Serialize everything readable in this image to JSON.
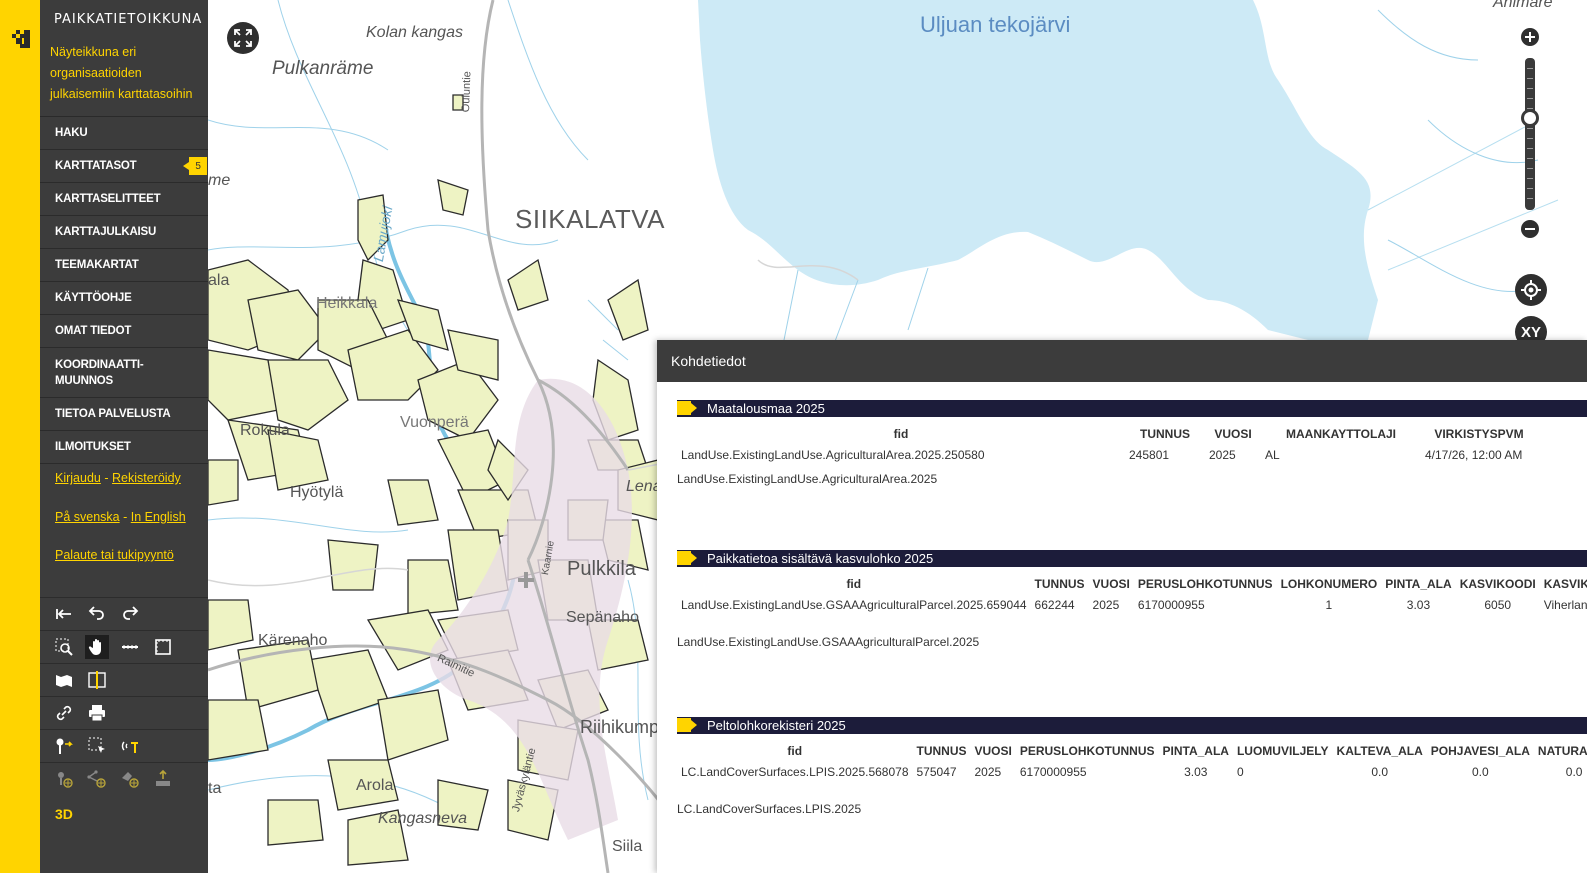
{
  "sidebar": {
    "brand": "PAIKKATIETOIKKUNA",
    "subtitle": "Näyteikkuna eri organisaatioiden julkaisemiin karttatasoihin",
    "menu": [
      {
        "label": "HAKU"
      },
      {
        "label": "KARTTATASOT",
        "badge": "5"
      },
      {
        "label": "KARTTASELITTEET"
      },
      {
        "label": "KARTTAJULKAISU"
      },
      {
        "label": "TEEMAKARTAT"
      },
      {
        "label": "KÄYTTÖOHJE"
      },
      {
        "label": "OMAT TIEDOT"
      },
      {
        "label": "KOORDINAATTI-\nMUUNNOS"
      },
      {
        "label": "TIETOA PALVELUSTA"
      },
      {
        "label": "ILMOITUKSET"
      }
    ],
    "login": "Kirjaudu",
    "register": "Rekisteröidy",
    "swedish": "På svenska",
    "english": "In English",
    "feedback": "Palaute tai tukipyyntö",
    "separator": "-",
    "button_3d": "3D"
  },
  "map": {
    "labels": {
      "lake": "Uljuan tekojärvi",
      "siikalatva": "SIIKALATVA",
      "kolankangas": "Kolan kangas",
      "pulkanrame": "Pulkanräme",
      "me": "me",
      "ala": "ala",
      "heikkala": "Heikkala",
      "rokula": "Rokula",
      "vuonpera": "Vuonperä",
      "hyotyla": "Hyötylä",
      "pulkkila": "Pulkkila",
      "sepanaho": "Sepänaho",
      "karenaho": "Kärenaho",
      "riihikump": "Riihikump",
      "arola": "Arola",
      "kangasneva": "Kangasneva",
      "lena": "Lena",
      "ta": "ta",
      "animare": "Animare",
      "siila": "Siila",
      "ouluntie": "Ouluntie",
      "lamujoki": "Lamujoki",
      "raimitie": "Raimitie",
      "jyvaskylantie": "Jyväskyläntie",
      "kaarnie": "Kaarnie"
    },
    "xy_button": "XY"
  },
  "popup": {
    "title": "Kohdetiedot",
    "sections": [
      {
        "title": "Maatalousmaa 2025",
        "headers": [
          "fid",
          "TUNNUS",
          "VUOSI",
          "MAANKAYTTOLAJI",
          "VIRKISTYSPVM"
        ],
        "rows": [
          [
            "LandUse.ExistingLandUse.AgriculturalArea.2025.250580",
            "245801",
            "2025",
            "AL",
            "4/17/26, 12:00 AM"
          ]
        ],
        "feature_type": "LandUse.ExistingLandUse.AgriculturalArea.2025"
      },
      {
        "title": "Paikkatietoa sisältävä kasvulohko 2025",
        "headers": [
          "fid",
          "TUNNUS",
          "VUOSI",
          "PERUSLOHKOTUNNUS",
          "LOHKONUMERO",
          "PINTA_ALA",
          "KASVIKOODI",
          "KASVIKOOD"
        ],
        "rows": [
          [
            "LandUse.ExistingLandUse.GSAAAgriculturalParcel.2025.659044",
            "662244",
            "2025",
            "6170000955",
            "1",
            "3.03",
            "6050",
            "Viherlannoi"
          ]
        ],
        "feature_type": "LandUse.ExistingLandUse.GSAAAgriculturalParcel.2025"
      },
      {
        "title": "Peltolohkorekisteri 2025",
        "headers": [
          "fid",
          "TUNNUS",
          "VUOSI",
          "PERUSLOHKOTUNNUS",
          "PINTA_ALA",
          "LUOMUVILJELY",
          "KALTEVA_ALA",
          "POHJAVESI_ALA",
          "NATURA_AL"
        ],
        "rows": [
          [
            "LC.LandCoverSurfaces.LPIS.2025.568078",
            "575047",
            "2025",
            "6170000955",
            "3.03",
            "0",
            "0.0",
            "0.0",
            "0.0"
          ]
        ],
        "feature_type": "LC.LandCoverSurfaces.LPIS.2025"
      }
    ]
  },
  "colors": {
    "accent": "#ffd400",
    "sidebar_bg": "#3c3c3c",
    "water": "#cdeaf6",
    "field": "#eef3c4",
    "section_bar": "#1c1c3a"
  },
  "icons": [
    "fullscreen-icon",
    "zoom-in-icon",
    "zoom-out-icon",
    "my-location-icon",
    "undo-all-icon",
    "undo-icon",
    "redo-icon",
    "zoom-box-icon",
    "pan-hand-icon",
    "measure-line-icon",
    "measure-area-icon",
    "map-layers-icon",
    "split-view-icon",
    "link-icon",
    "print-icon",
    "marker-icon",
    "select-features-icon",
    "antenna-icon",
    "add-point-icon",
    "add-line-icon",
    "add-area-icon",
    "import-icon"
  ]
}
